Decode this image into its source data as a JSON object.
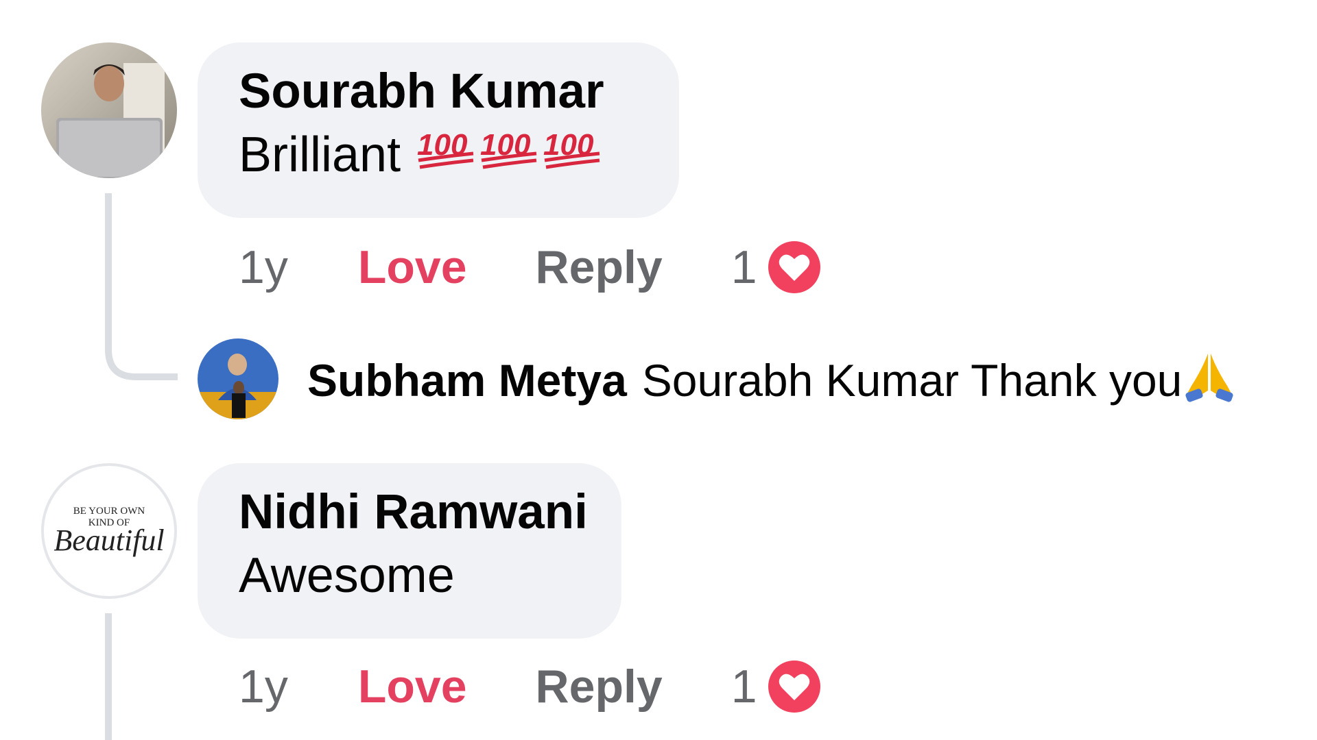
{
  "comments": [
    {
      "author": "Sourabh Kumar",
      "text": "Brilliant",
      "emoji_icons": [
        "hundred-points-icon",
        "hundred-points-icon",
        "hundred-points-icon"
      ],
      "time": "1y",
      "love_label": "Love",
      "reply_label": "Reply",
      "reaction_count": "1",
      "reaction_icon": "love-reaction-icon",
      "reply": {
        "author": "Subham Metya",
        "text": "Sourabh Kumar Thank you",
        "emoji_icon": "folded-hands-icon"
      }
    },
    {
      "author": "Nidhi Ramwani",
      "text": "Awesome",
      "avatar_text": {
        "line1": "BE YOUR OWN",
        "line2": "KIND OF",
        "line3": "Beautiful"
      },
      "time": "1y",
      "love_label": "Love",
      "reply_label": "Reply",
      "reaction_count": "1",
      "reaction_icon": "love-reaction-icon"
    }
  ],
  "colors": {
    "bubble_bg": "#f0f2f5",
    "love_active": "#e4405f",
    "meta_text": "#65676b",
    "thread_line": "#dadde1"
  }
}
